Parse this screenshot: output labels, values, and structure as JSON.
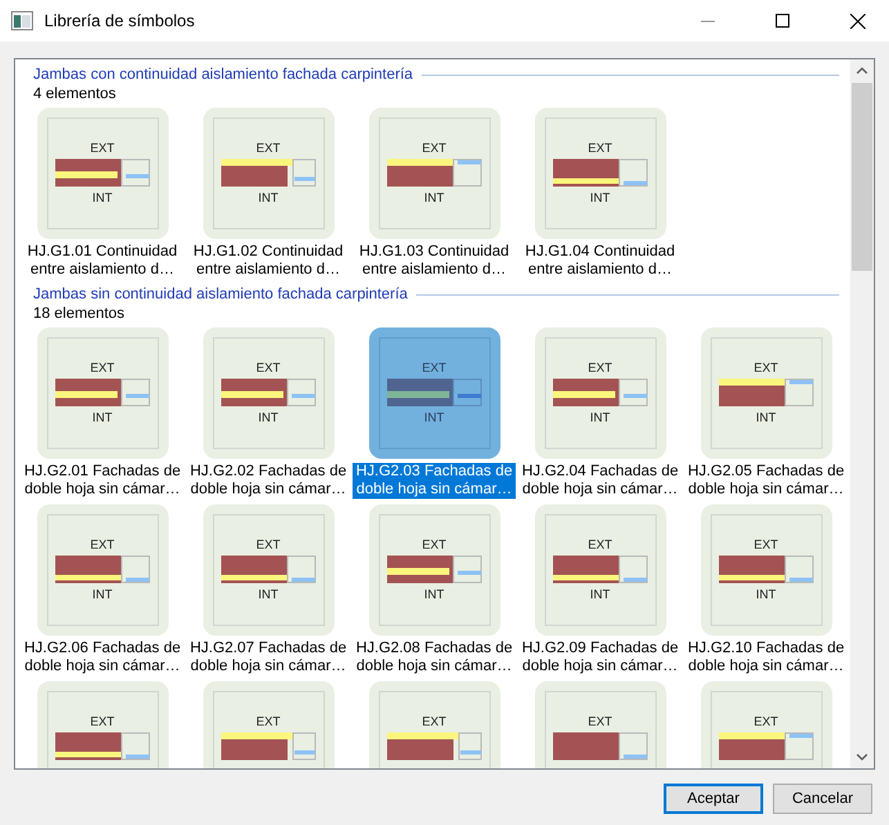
{
  "window": {
    "title": "Librería de símbolos"
  },
  "groups": [
    {
      "title": "Jambas con continuidad aislamiento fachada carpintería",
      "count": "4 elementos",
      "items": [
        {
          "top_label": "EXT",
          "bottom_label": "INT",
          "kind": "mid",
          "caption": "HJ.G1.01 Continuidad entre aislamiento d…",
          "selected": false
        },
        {
          "top_label": "EXT",
          "bottom_label": "INT",
          "kind": "top",
          "caption": "HJ.G1.02 Continuidad entre aislamiento d…",
          "selected": false
        },
        {
          "top_label": "EXT",
          "bottom_label": "INT",
          "kind": "high",
          "caption": "HJ.G1.03 Continuidad entre aislamiento d…",
          "selected": false
        },
        {
          "top_label": "EXT",
          "bottom_label": "INT",
          "kind": "low",
          "caption": "HJ.G1.04 Continuidad entre aislamiento d…",
          "selected": false
        }
      ]
    },
    {
      "title": "Jambas sin continuidad aislamiento fachada carpintería",
      "count": "18 elementos",
      "items": [
        {
          "top_label": "EXT",
          "bottom_label": "INT",
          "kind": "mid",
          "caption": "HJ.G2.01 Fachadas de doble hoja sin cámar…",
          "selected": false
        },
        {
          "top_label": "EXT",
          "bottom_label": "INT",
          "kind": "mid",
          "caption": "HJ.G2.02 Fachadas de doble hoja sin cámar…",
          "selected": false
        },
        {
          "top_label": "EXT",
          "bottom_label": "INT",
          "kind": "mid",
          "caption": "HJ.G2.03 Fachadas de doble hoja sin cámar…",
          "selected": true
        },
        {
          "top_label": "EXT",
          "bottom_label": "INT",
          "kind": "mid",
          "caption": "HJ.G2.04 Fachadas de doble hoja sin cámar…",
          "selected": false
        },
        {
          "top_label": "EXT",
          "bottom_label": "INT",
          "kind": "high",
          "caption": "HJ.G2.05 Fachadas de doble hoja sin cámar…",
          "selected": false
        },
        {
          "top_label": "EXT",
          "bottom_label": "INT",
          "kind": "low",
          "caption": "HJ.G2.06 Fachadas de doble hoja sin cámar…",
          "selected": false
        },
        {
          "top_label": "EXT",
          "bottom_label": "INT",
          "kind": "low",
          "caption": "HJ.G2.07 Fachadas de doble hoja sin cámar…",
          "selected": false
        },
        {
          "top_label": "EXT",
          "bottom_label": "INT",
          "kind": "mid",
          "caption": "HJ.G2.08 Fachadas de doble hoja sin cámar…",
          "selected": false
        },
        {
          "top_label": "EXT",
          "bottom_label": "INT",
          "kind": "low",
          "caption": "HJ.G2.09 Fachadas de doble hoja sin cámar…",
          "selected": false
        },
        {
          "top_label": "EXT",
          "bottom_label": "INT",
          "kind": "low",
          "caption": "HJ.G2.10 Fachadas de doble hoja sin cámar…",
          "selected": false
        },
        {
          "top_label": "EXT",
          "kind": "low",
          "selected": false
        },
        {
          "top_label": "EXT",
          "kind": "top",
          "selected": false
        },
        {
          "top_label": "EXT",
          "kind": "top",
          "selected": false
        },
        {
          "top_label": "EXT",
          "kind": "plain",
          "selected": false
        },
        {
          "top_label": "EXT",
          "kind": "high",
          "selected": false
        }
      ]
    }
  ],
  "buttons": [
    {
      "label": "Aceptar",
      "kind": "default"
    },
    {
      "label": "Cancelar",
      "kind": "normal"
    }
  ]
}
